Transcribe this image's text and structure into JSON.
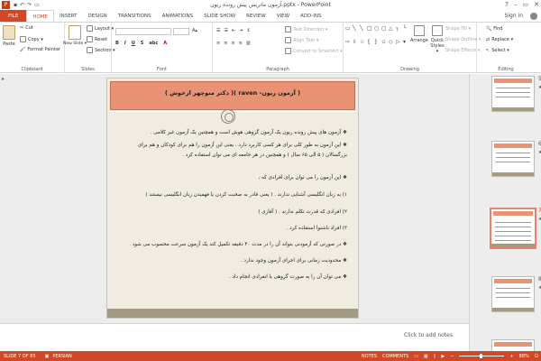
{
  "window": {
    "title": "آزمون ماتریس پیش رونده ریون.pptx - PowerPoint",
    "help": "?",
    "min": "–",
    "max": "▭",
    "close": "✕",
    "sign_in": "Sign in"
  },
  "tabs": [
    "FILE",
    "HOME",
    "INSERT",
    "DESIGN",
    "TRANSITIONS",
    "ANIMATIONS",
    "SLIDE SHOW",
    "REVIEW",
    "VIEW",
    "ADD-INS"
  ],
  "ribbon": {
    "clipboard": {
      "label": "Clipboard",
      "paste": "Paste",
      "cut": "Cut",
      "copy": "Copy ▾",
      "format_painter": "Format Painter"
    },
    "slides": {
      "label": "Slides",
      "new_slide": "New Slide ▾",
      "layout": "Layout ▾",
      "reset": "Reset",
      "section": "Section ▾"
    },
    "font": {
      "label": "Font"
    },
    "paragraph": {
      "label": "Paragraph",
      "text_direction": "Text Direction ▾",
      "align_text": "Align Text ▾",
      "convert": "Convert to SmartArt ▾"
    },
    "drawing": {
      "label": "Drawing",
      "arrange": "Arrange",
      "quick_styles": "Quick Styles ▾",
      "shape_fill": "Shape Fill ▾",
      "shape_outline": "Shape Outline ▾",
      "shape_effects": "Shape Effects ▾"
    },
    "editing": {
      "label": "Editing",
      "find": "Find",
      "replace": "Replace ▾",
      "select": "Select ▾"
    }
  },
  "slide": {
    "title": "( آزمون ریون- raven )( دکتر منوچهر ازخوش )",
    "lines": [
      "❖ آزمون های پیش رونده ریون یک آزمون گروهی هوش است و همچنین یک آزمون غیر کلامی .",
      "❖ این آزمون به طور کلی برای هر کسی کاربرد دارد . یعنی این آزمون را هم برای کودکان و هم برای",
      "بزرگسالان ( ۵ الی ۶۵ سال ) و همچنین در هر جامعه ای می توان استفاده کرد .",
      "❖ این آزمون را می توان برای افرادی که ،",
      "۱) به زبان انگلیسی آشنایی ندارند . ( یعنی قادر به صحبت کردن یا فهمیدن زبان انگلیسی نیستند )",
      "۲) افرادی که قدرت تکلم ندارند . ( آفازی )",
      "۳) افراد ناشنوا استفاده کرد .",
      "❖ در صورتی که آزمودنی بتواند آن را در مدت ۴۰ دقیقه تکمیل کند یک آزمون سرعت محسوب می شود .",
      "❖ محدودیت زمانی برای اجرای آزمون وجود ندارد .",
      "❖ می توان آن را به صورت گروهی یا انفرادی انجام داد ."
    ]
  },
  "thumbnails": [
    {
      "num": "5",
      "star": "★"
    },
    {
      "num": "6",
      "star": "★"
    },
    {
      "num": "7",
      "star": "★"
    },
    {
      "num": "8",
      "star": "★"
    },
    {
      "num": "9",
      "star": ""
    }
  ],
  "notes": {
    "placeholder": "Click to add notes"
  },
  "status": {
    "slide": "SLIDE 7 OF 85",
    "language": "PERSIAN",
    "notes": "NOTES",
    "comments": "COMMENTS",
    "zoom": "88%"
  }
}
